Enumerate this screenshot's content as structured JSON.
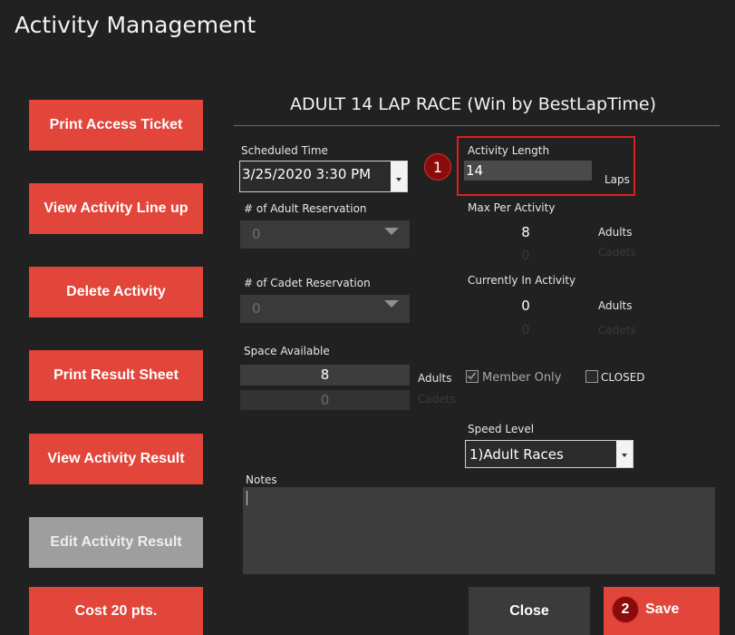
{
  "window": {
    "title": "Activity Management"
  },
  "sidebar": {
    "buttons": [
      {
        "label": "Print Access Ticket"
      },
      {
        "label": "View Activity Line up"
      },
      {
        "label": "Delete Activity"
      },
      {
        "label": "Print Result Sheet"
      },
      {
        "label": "View Activity Result"
      },
      {
        "label": "Edit Activity Result",
        "disabled": true
      },
      {
        "label": "Cost 20 pts."
      }
    ]
  },
  "activity": {
    "title": "ADULT 14 LAP RACE (Win by BestLapTime)",
    "scheduled_time": {
      "label": "Scheduled Time",
      "value": "3/25/2020 3:30 PM"
    },
    "adult_reservation": {
      "label": "# of Adult Reservation",
      "value": "0"
    },
    "cadet_reservation": {
      "label": "# of Cadet Reservation",
      "value": "0"
    },
    "space_available": {
      "label": "Space Available",
      "adults": "8",
      "adults_unit": "Adults",
      "cadets": "0",
      "cadets_unit": "Cadets"
    },
    "activity_length": {
      "label": "Activity Length",
      "value": "14",
      "unit": "Laps",
      "badge": "1"
    },
    "max_per_activity": {
      "label": "Max Per Activity",
      "adults": "8",
      "adults_unit": "Adults",
      "cadets": "0",
      "cadets_unit": "Cadets"
    },
    "currently_in_activity": {
      "label": "Currently In Activity",
      "adults": "0",
      "adults_unit": "Adults",
      "cadets": "0",
      "cadets_unit": "Cadets"
    },
    "member_only": {
      "label": "Member Only",
      "checked": true
    },
    "closed": {
      "label": "CLOSED",
      "checked": false
    },
    "speed_level": {
      "label": "Speed Level",
      "value": "1)Adult Races"
    },
    "notes": {
      "label": "Notes",
      "value": ""
    }
  },
  "actions": {
    "close_label": "Close",
    "save_label": "Save",
    "save_badge": "2"
  },
  "colors": {
    "accent": "#e2453a",
    "background": "#212121",
    "highlight_border": "#e11d1d",
    "badge": "#8b0b0b"
  }
}
